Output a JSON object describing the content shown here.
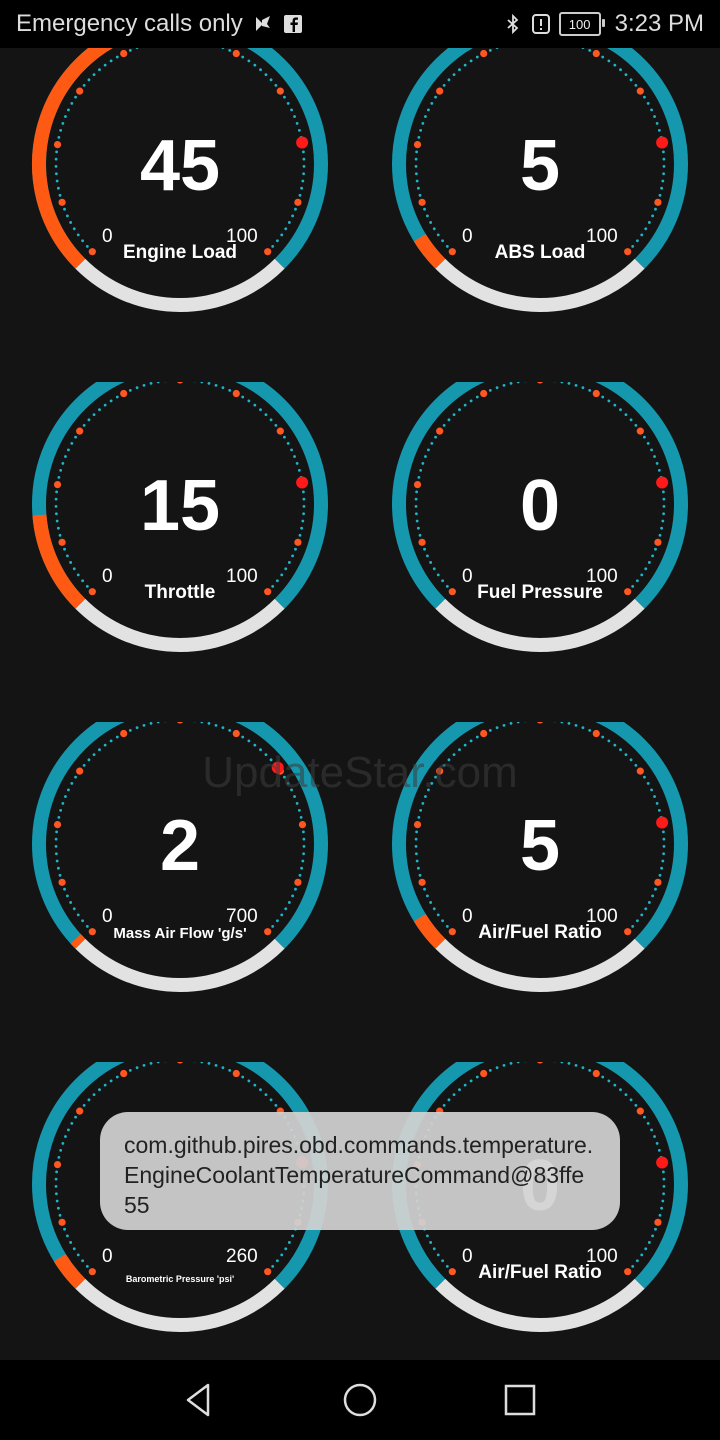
{
  "status_bar": {
    "carrier_text": "Emergency calls only",
    "battery": "100",
    "time": "3:23 PM",
    "icons": [
      "signal-flag-icon",
      "facebook-icon",
      "bluetooth-icon",
      "alert-icon",
      "battery-icon"
    ]
  },
  "gauges": [
    {
      "value": "45",
      "label": "Engine Load",
      "min": "0",
      "max": "100",
      "level": 0.45
    },
    {
      "value": "5",
      "label": "ABS Load",
      "min": "0",
      "max": "100",
      "level": 0.05
    },
    {
      "value": "15",
      "label": "Throttle",
      "min": "0",
      "max": "100",
      "level": 0.15
    },
    {
      "value": "0",
      "label": "Fuel Pressure",
      "min": "0",
      "max": "100",
      "level": 0.0
    },
    {
      "value": "2",
      "label": "Mass Air Flow 'g/s'",
      "min": "0",
      "max": "700",
      "level": 0.003
    },
    {
      "value": "5",
      "label": "Air/Fuel Ratio",
      "min": "0",
      "max": "100",
      "level": 0.05
    },
    {
      "value": "",
      "label": "Barometric Pressure 'psi'",
      "min": "0",
      "max": "260",
      "level": 0.05
    },
    {
      "value": "0",
      "label": "Air/Fuel Ratio",
      "min": "0",
      "max": "100",
      "level": 0.0
    }
  ],
  "watermark": "UpdateStar.com",
  "toast": {
    "message": "com.github.pires.obd.commands.temperature.EngineCoolantTemperatureCommand@83ffe55"
  },
  "nav_bar": {
    "icons": [
      "back-icon",
      "home-icon",
      "recents-icon"
    ]
  },
  "colors": {
    "background": "#141414",
    "ring_teal": "#1597ae",
    "ring_orange": "#ff5a14",
    "ring_grey": "#e2e2e2",
    "tick_orange": "#ff5722",
    "marker_red": "#ff1a1a",
    "dot_teal": "#1fb5c9"
  }
}
